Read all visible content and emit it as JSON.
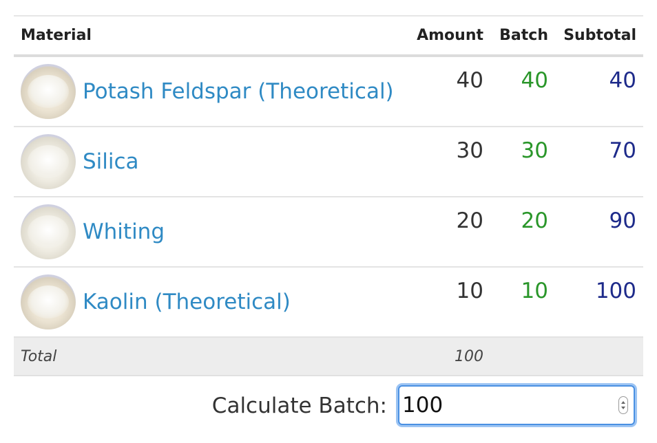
{
  "table": {
    "headers": {
      "material": "Material",
      "amount": "Amount",
      "batch": "Batch",
      "subtotal": "Subtotal"
    },
    "rows": [
      {
        "material": "Potash Feldspar (Theoretical)",
        "thumbnail": "potash-feldspar-powder-image",
        "amount": "40",
        "batch": "40",
        "subtotal": "40"
      },
      {
        "material": "Silica",
        "thumbnail": "silica-powder-image",
        "amount": "30",
        "batch": "30",
        "subtotal": "70"
      },
      {
        "material": "Whiting",
        "thumbnail": "whiting-powder-image",
        "amount": "20",
        "batch": "20",
        "subtotal": "90"
      },
      {
        "material": "Kaolin (Theoretical)",
        "thumbnail": "kaolin-powder-image",
        "amount": "10",
        "batch": "10",
        "subtotal": "100"
      }
    ],
    "total": {
      "label": "Total",
      "amount": "100"
    }
  },
  "calculate": {
    "label": "Calculate Batch:",
    "value": "100"
  },
  "colors": {
    "link": "#2f8ac4",
    "batch": "#2a962a",
    "subtotal": "#1d2a8a",
    "focus": "#4a90e2"
  }
}
